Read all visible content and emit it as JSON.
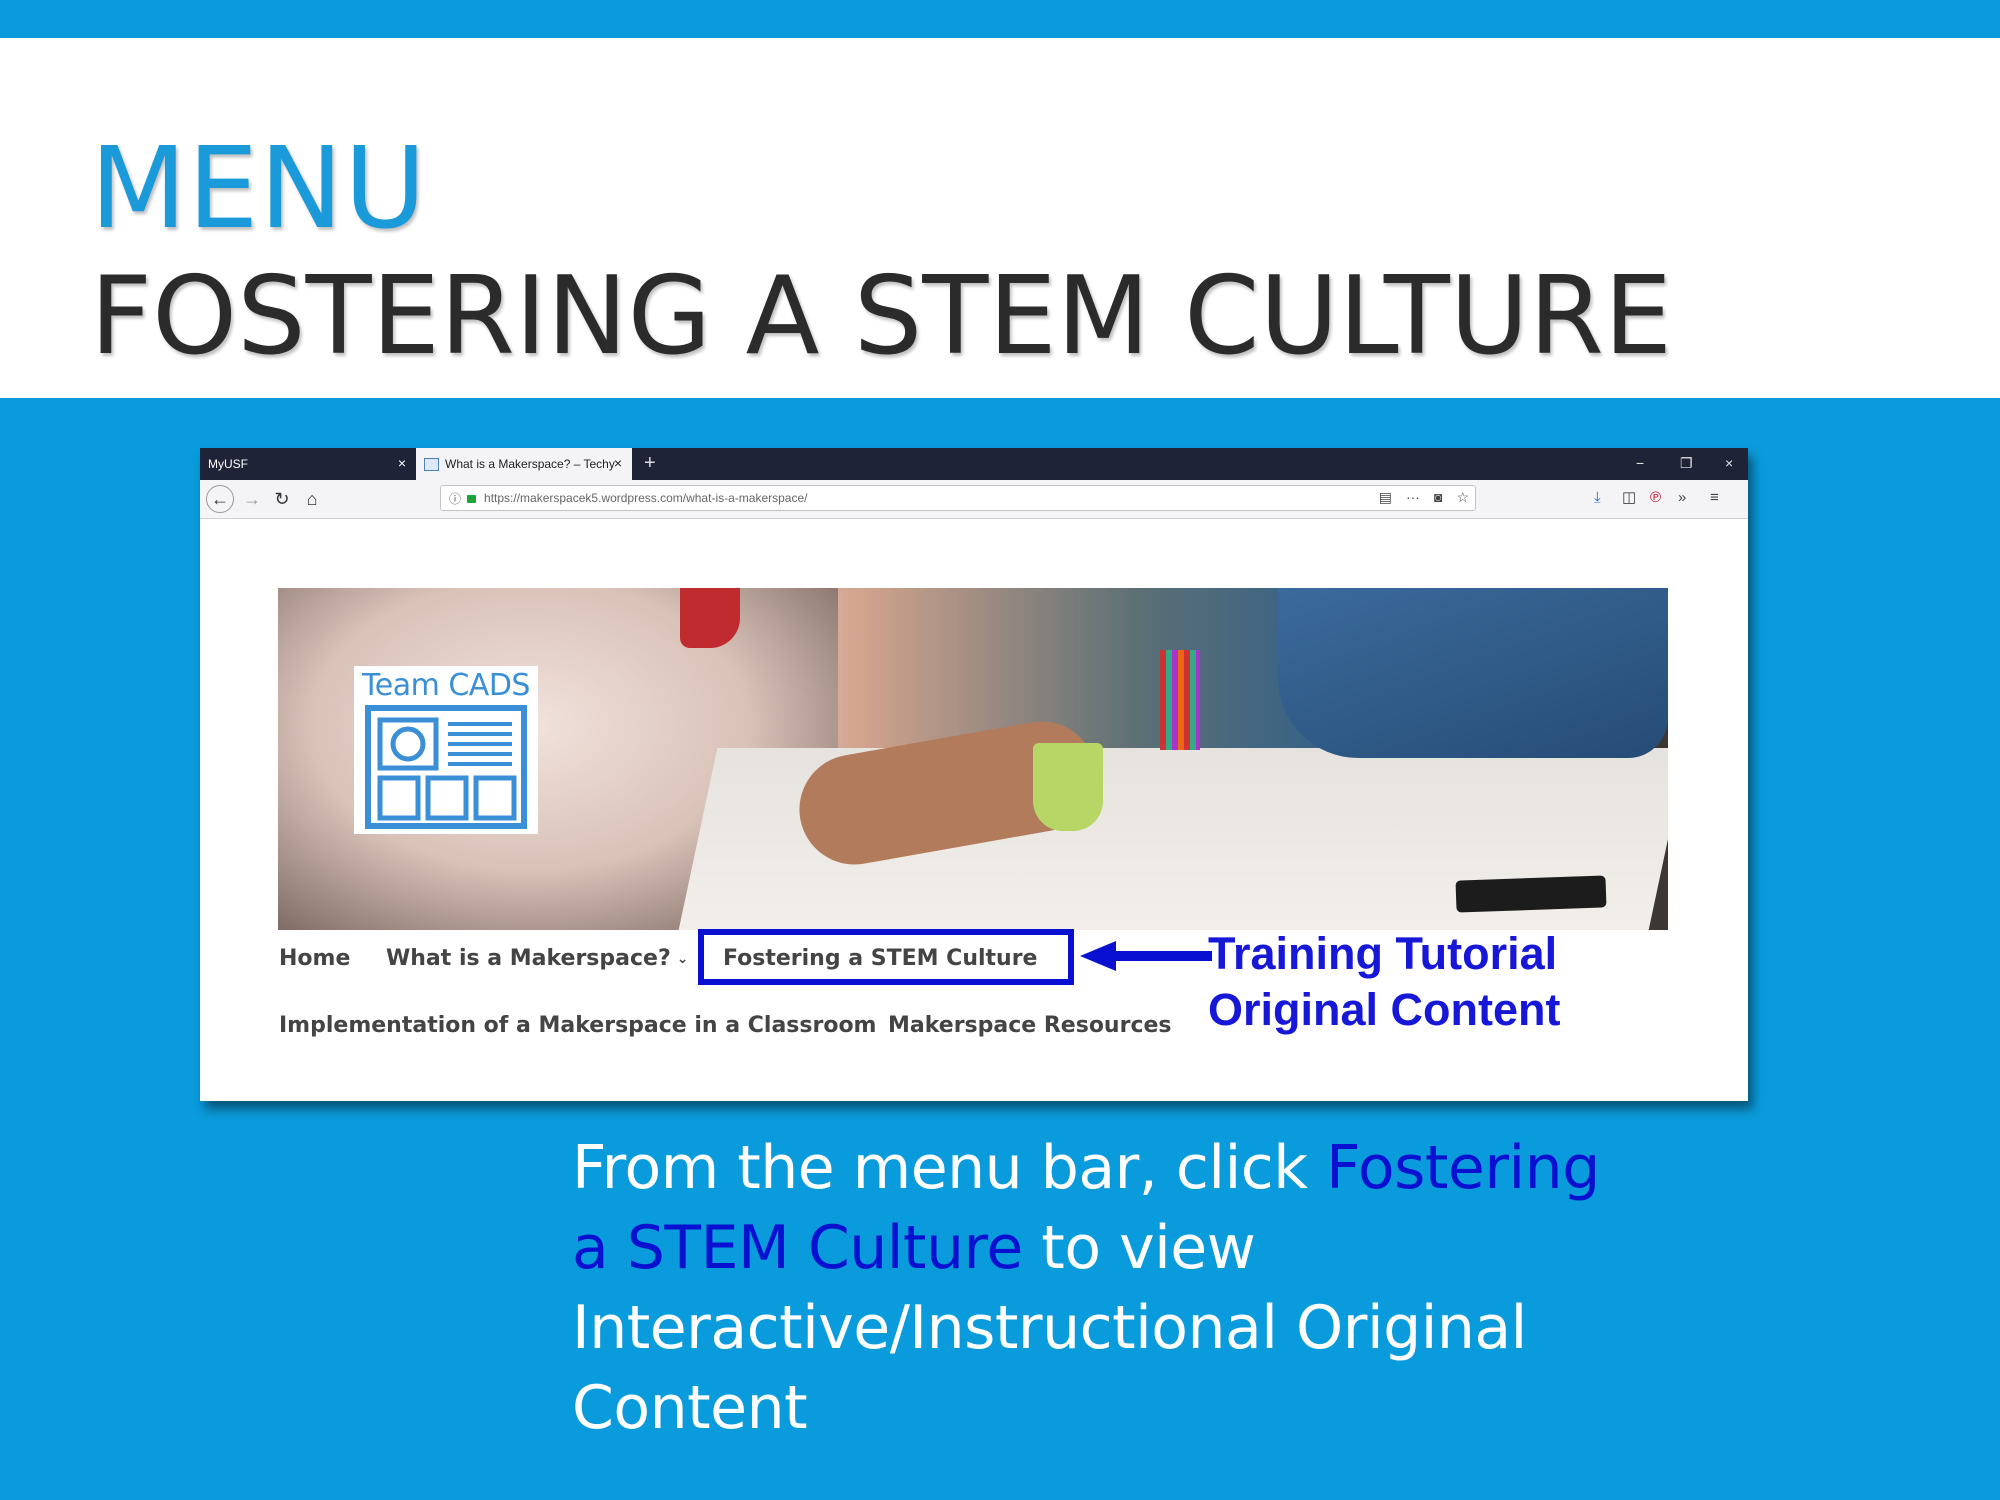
{
  "slide": {
    "title": "MENU",
    "subtitle": "FOSTERING A STEM CULTURE",
    "instruction_before": "From the menu bar, click ",
    "instruction_link": "Fostering a STEM Culture",
    "instruction_after": " to view Interactive/Instructional Original Content",
    "colors": {
      "background": "#0a9bdc",
      "title_blue": "#1a9ad9",
      "highlight": "#0a10d0"
    }
  },
  "browser": {
    "tabs": [
      {
        "title": "MyUSF",
        "close": "×",
        "icon": "favicon-icon"
      },
      {
        "title": "What is a Makerspace? – Techy",
        "close": "×",
        "icon": "favicon-icon"
      }
    ],
    "new_tab": "+",
    "window_controls": {
      "minimize": "−",
      "restore": "❐",
      "close": "×"
    },
    "nav": {
      "back": "←",
      "forward": "→",
      "reload": "↻",
      "home": "⌂"
    },
    "url": "https://makerspacek5.wordpress.com/what-is-a-makerspace/",
    "url_actions": {
      "reader": "▤",
      "more": "···",
      "pocket": "◙",
      "bookmark": "☆"
    },
    "toolbar": {
      "download": "⤓",
      "sidebar": "◫",
      "pinterest": "℗",
      "overflow": "»",
      "menu": "≡"
    }
  },
  "site": {
    "logo_text": "Team CADS",
    "menu": [
      {
        "label": "Home"
      },
      {
        "label": "What is a Makerspace?",
        "has_dropdown": true,
        "caret": "⌄"
      },
      {
        "label": "Fostering a STEM Culture",
        "highlighted": true
      },
      {
        "label": "Implementation of a Makerspace in a Classroom"
      },
      {
        "label": "Makerspace Resources"
      }
    ],
    "annotation": {
      "line1": "Training Tutorial",
      "line2": "Original Content"
    }
  }
}
